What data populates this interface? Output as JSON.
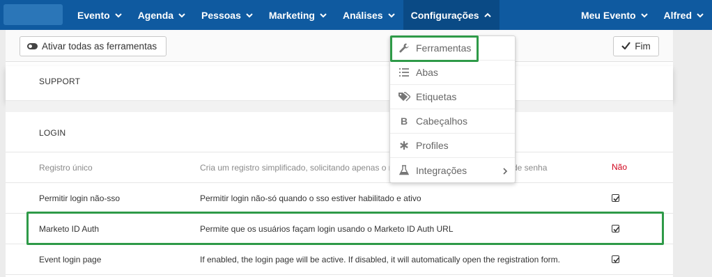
{
  "nav": {
    "left": [
      "Evento",
      "Agenda",
      "Pessoas",
      "Marketing",
      "Análises",
      "Configurações"
    ],
    "right": [
      "Meu Evento",
      "Alfred"
    ]
  },
  "toolbar": {
    "activate_label": "Ativar todas as ferramentas",
    "fim_label": "Fim"
  },
  "sections": {
    "support": "SUPPORT",
    "login": "LOGIN"
  },
  "rows": [
    {
      "name": "Registro único",
      "desc": "Cria um registro simplificado, solicitando apenas o n",
      "desc_tail": "de senha",
      "value": "Não"
    },
    {
      "name": "Permitir login não-sso",
      "desc": "Permitir login não-só quando o sso estiver habilitado e ativo",
      "value": "checked"
    },
    {
      "name": "Marketo ID Auth",
      "desc": "Permite que os usuários façam login usando o Marketo ID Auth URL",
      "value": "checked"
    },
    {
      "name": "Event login page",
      "desc": "If enabled, the login page will be active. If disabled, it will automatically open the registration form.",
      "value": "checked"
    }
  ],
  "dropdown": {
    "items": [
      {
        "label": "Ferramentas",
        "icon": "wrench-icon"
      },
      {
        "label": "Abas",
        "icon": "list-icon"
      },
      {
        "label": "Etiquetas",
        "icon": "tags-icon"
      },
      {
        "label": "Cabeçalhos",
        "icon": "bold-b-icon"
      },
      {
        "label": "Profiles",
        "icon": "asterisk-icon"
      },
      {
        "label": "Integrações",
        "icon": "flask-icon"
      }
    ]
  },
  "colors": {
    "nav_bg": "#0f5aa0",
    "highlight": "#2e9a48",
    "no_value": "#d0021b"
  }
}
